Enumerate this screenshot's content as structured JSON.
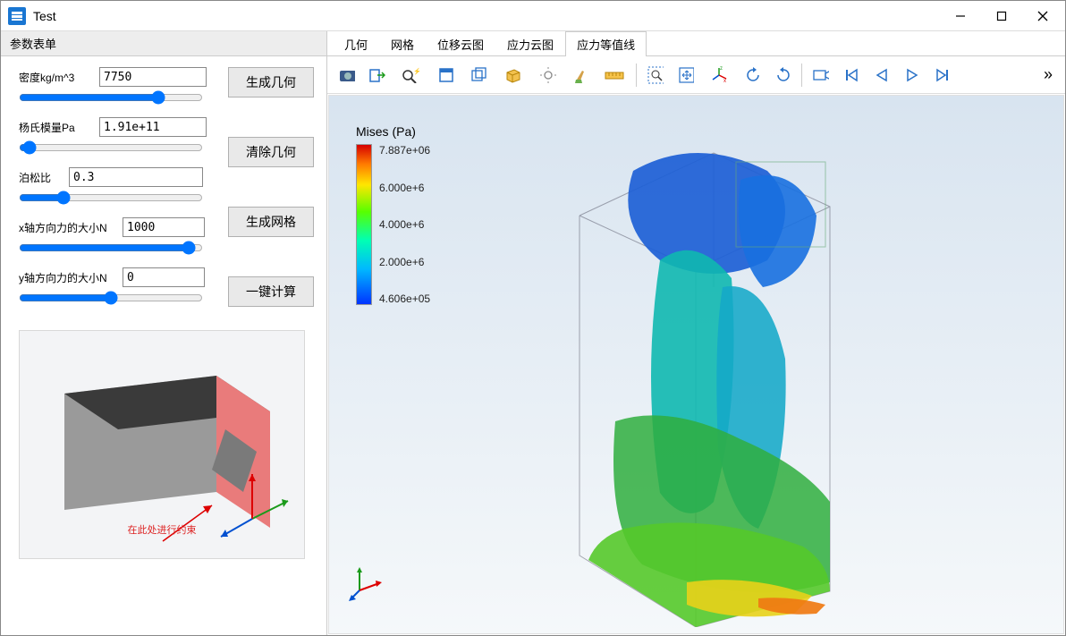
{
  "window": {
    "title": "Test"
  },
  "left_panel": {
    "title": "参数表单",
    "fields": {
      "density": {
        "label": "密度kg/m^3",
        "value": "7750"
      },
      "young": {
        "label": "杨氏模量Pa",
        "value": "1.91e+11"
      },
      "poisson": {
        "label": "泊松比",
        "value": "0.3"
      },
      "force_x": {
        "label": "x轴方向力的大小N",
        "value": "1000"
      },
      "force_y": {
        "label": "y轴方向力的大小N",
        "value": "0"
      }
    },
    "buttons": {
      "gen_geom": "生成几何",
      "clear_geom": "清除几何",
      "gen_mesh": "生成网格",
      "compute": "一键计算"
    },
    "preview_caption": "在此处进行约束"
  },
  "tabs": [
    {
      "id": "geom",
      "label": "几何"
    },
    {
      "id": "mesh",
      "label": "网格"
    },
    {
      "id": "disp",
      "label": "位移云图"
    },
    {
      "id": "stress",
      "label": "应力云图"
    },
    {
      "id": "iso",
      "label": "应力等值线",
      "active": true
    }
  ],
  "legend": {
    "title": "Mises (Pa)",
    "ticks": [
      "7.887e+06",
      "6.000e+6",
      "4.000e+6",
      "2.000e+6",
      "4.606e+05"
    ]
  },
  "chart_data": {
    "type": "heatmap",
    "title": "Mises (Pa)",
    "scale": "linear",
    "min": 460600.0,
    "max": 7887000.0,
    "ticks": [
      460600.0,
      2000000.0,
      4000000.0,
      6000000.0,
      7887000.0
    ],
    "colormap": [
      "#0034ff",
      "#00b8ff",
      "#00ffb4",
      "#57ff00",
      "#ffe600",
      "#ff7a00",
      "#d60000"
    ]
  }
}
